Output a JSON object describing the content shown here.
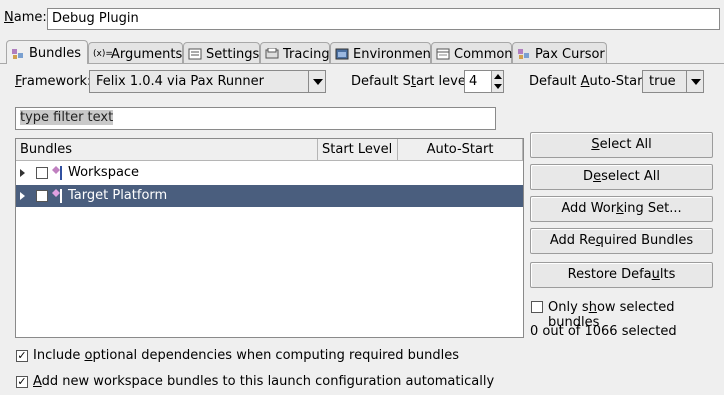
{
  "name": {
    "label": "Name:",
    "value": "Debug Plugin"
  },
  "tabs": [
    {
      "label": "Bundles",
      "icon": "bundles-icon",
      "active": true
    },
    {
      "label": "Arguments",
      "icon": "arguments-icon"
    },
    {
      "label": "Settings",
      "icon": "settings-icon"
    },
    {
      "label": "Tracing",
      "icon": "tracing-icon"
    },
    {
      "label": "Environment",
      "icon": "environment-icon"
    },
    {
      "label": "Common",
      "icon": "common-icon"
    },
    {
      "label": "Pax Cursor",
      "icon": "pax-cursor-icon"
    }
  ],
  "framework": {
    "label": "Framework:",
    "value": "Felix 1.0.4 via Pax Runner"
  },
  "start_level": {
    "label": "Default Start level:",
    "value": "4"
  },
  "auto_start": {
    "label": "Default Auto-Start:",
    "value": "true"
  },
  "filter": {
    "placeholder": "type filter text"
  },
  "table": {
    "columns": [
      "Bundles",
      "Start Level",
      "Auto-Start"
    ],
    "rows": [
      {
        "label": "Workspace",
        "checked": false,
        "selected": false
      },
      {
        "label": "Target Platform",
        "checked": false,
        "selected": true
      }
    ]
  },
  "buttons": {
    "select_all": "Select All",
    "deselect_all": "Deselect All",
    "add_working_set": "Add Working Set...",
    "add_required": "Add Required Bundles",
    "restore_defaults": "Restore Defaults"
  },
  "only_show_selected": {
    "label": "Only show selected bundles",
    "checked": false
  },
  "selection_count": "0 out of 1066 selected",
  "include_optional": {
    "label": "Include optional dependencies when computing required bundles",
    "checked": true
  },
  "add_new_workspace": {
    "label": "Add new workspace bundles to this launch configuration automatically",
    "checked": true
  },
  "colors": {
    "selection": "#4a5e7e",
    "background": "#efefef"
  }
}
